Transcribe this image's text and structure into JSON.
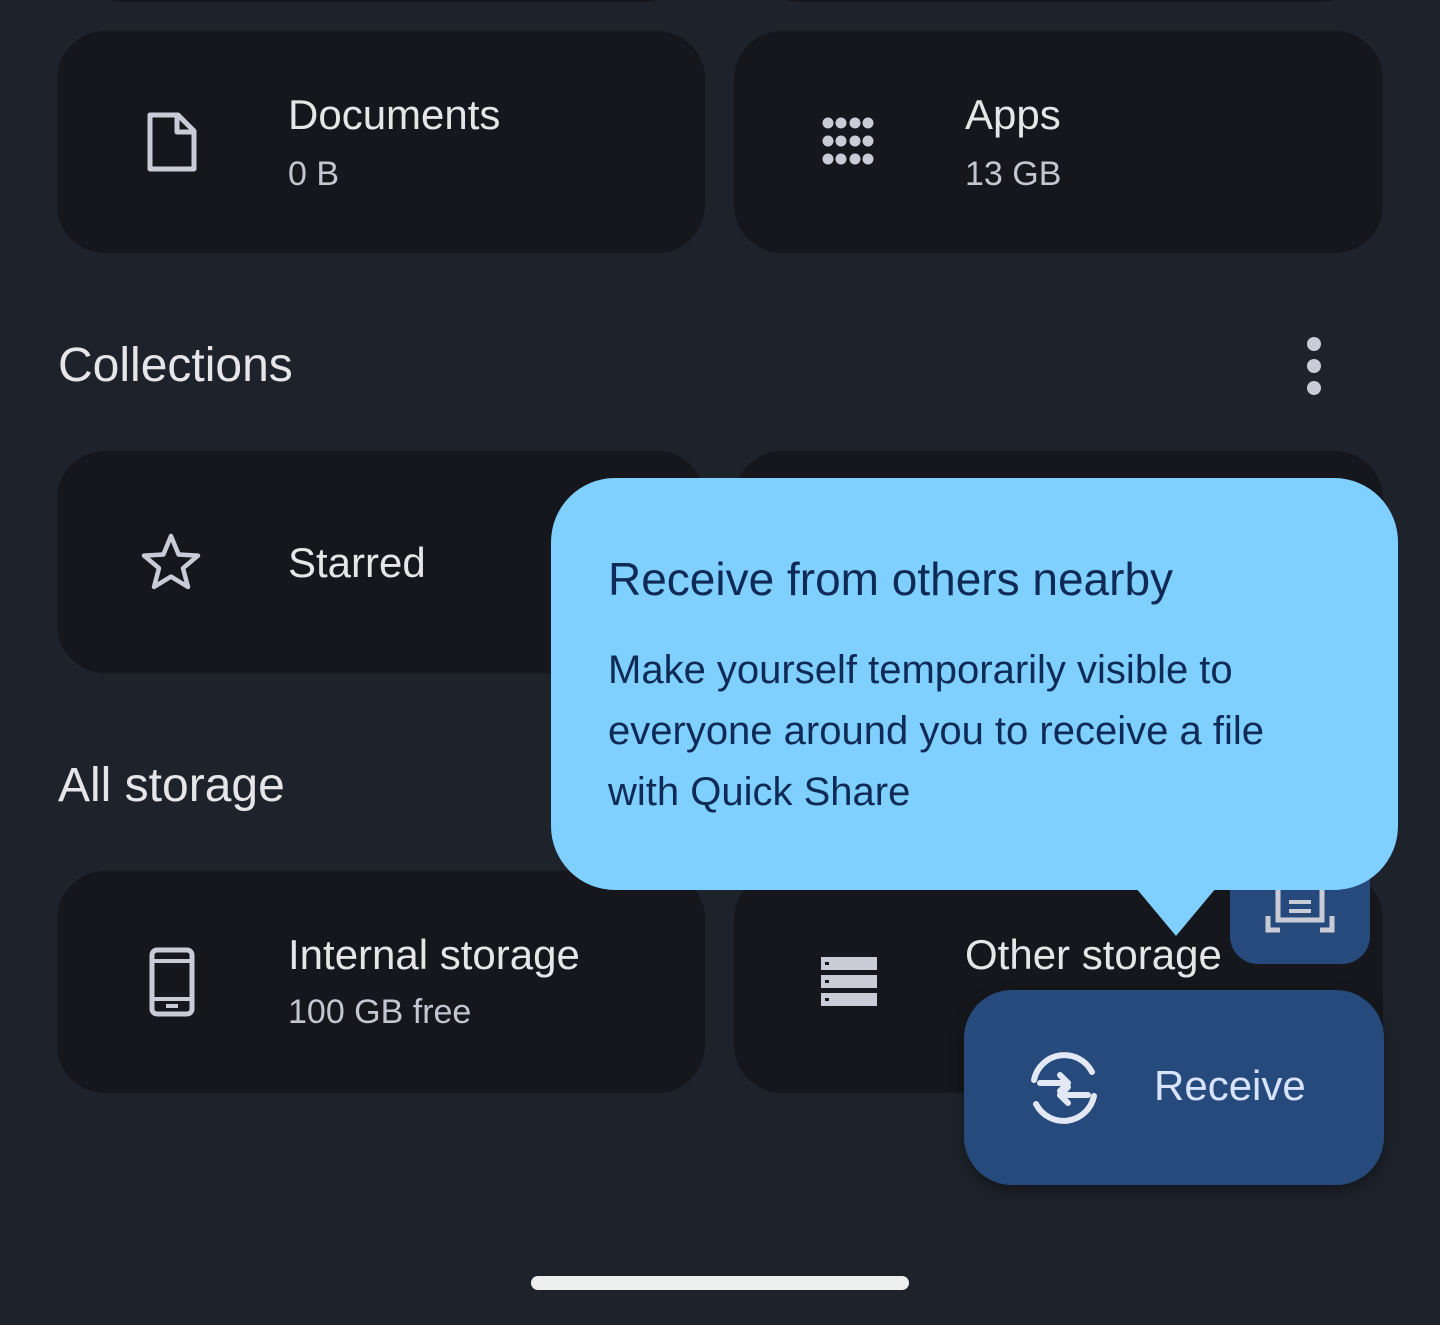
{
  "categories": {
    "documents": {
      "title": "Documents",
      "size": "0 B",
      "icon": "document-icon"
    },
    "apps": {
      "title": "Apps",
      "size": "13 GB",
      "icon": "apps-grid-icon"
    }
  },
  "collections": {
    "heading": "Collections",
    "more_icon": "more-vert-icon",
    "starred": {
      "title": "Starred",
      "icon": "star-outline-icon"
    }
  },
  "all_storage": {
    "heading": "All storage",
    "internal": {
      "title": "Internal storage",
      "free": "100 GB free",
      "icon": "phone-icon"
    },
    "other": {
      "title": "Other storage",
      "icon": "storage-icon"
    }
  },
  "tooltip": {
    "title": "Receive from others nearby",
    "body": "Make yourself temporarily visible to everyone around you to receive a file with Quick Share"
  },
  "fab": {
    "scan_icon": "document-scanner-icon",
    "receive_label": "Receive",
    "receive_icon": "quick-share-receive-icon"
  },
  "colors": {
    "background": "#1e222b",
    "card": "#15171c",
    "tooltip": "#7fcfff",
    "tooltip_text": "#0e2a55",
    "fab": "#264a7b",
    "icon": "#c9ccd6"
  }
}
